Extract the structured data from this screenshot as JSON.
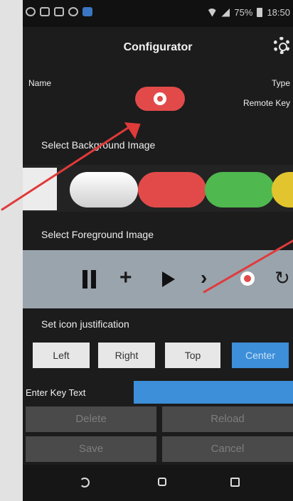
{
  "app": {
    "title": "Configurator",
    "settings_icon": "gear-icon"
  },
  "status_bar": {
    "battery_percent": "75%",
    "time": "18:50"
  },
  "header": {
    "name_label": "Name",
    "type_label": "Type",
    "type_value": "Remote Key"
  },
  "sections": {
    "background": "Select Background Image",
    "foreground": "Select Foreground Image",
    "justification": "Set icon justification",
    "key_text": "Enter Key Text"
  },
  "background_swatches": [
    {
      "name": "white",
      "color": "#ececec"
    },
    {
      "name": "red",
      "color": "#e24a4a"
    },
    {
      "name": "green",
      "color": "#4fb84f"
    },
    {
      "name": "yellow",
      "color": "#e2c52e"
    }
  ],
  "foreground_icons": [
    "pause-icon",
    "plus-icon",
    "play-icon",
    "chevron-right-icon",
    "record-icon",
    "refresh-icon"
  ],
  "justification_buttons": [
    {
      "label": "Left",
      "selected": false
    },
    {
      "label": "Right",
      "selected": false
    },
    {
      "label": "Top",
      "selected": false
    },
    {
      "label": "Center",
      "selected": true
    }
  ],
  "key_text_input": {
    "value": "",
    "placeholder": ""
  },
  "actions": {
    "delete": "Delete",
    "reload": "Reload",
    "save": "Save",
    "cancel": "Cancel"
  },
  "colors": {
    "accent": "#3d8fd9",
    "button_red": "#e24a4a",
    "annotation_arrow": "#e03a3a"
  }
}
